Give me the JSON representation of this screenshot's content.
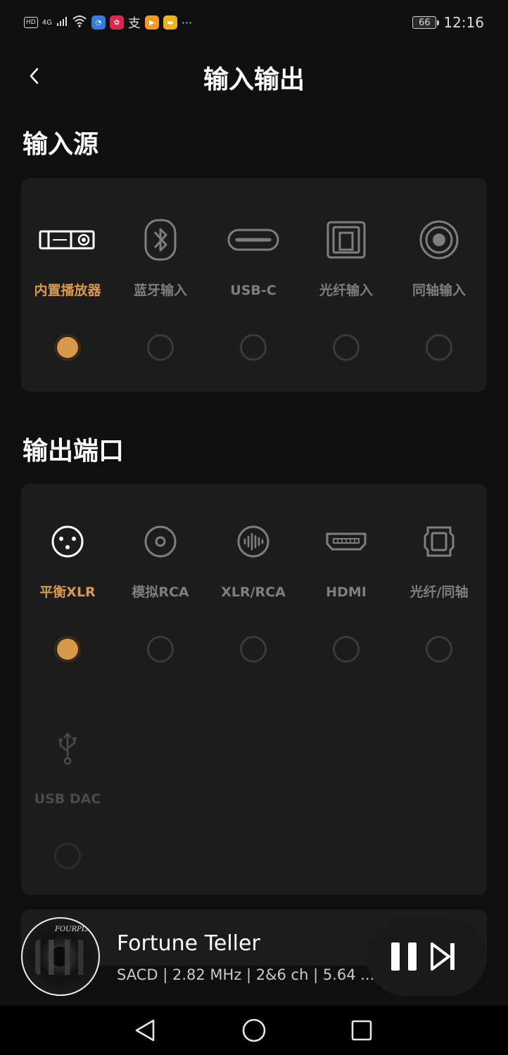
{
  "status_bar": {
    "left_label": "HD",
    "network": "4G",
    "battery": "66",
    "time": "12:16",
    "more": "···"
  },
  "header": {
    "title": "输入输出"
  },
  "input_section": {
    "title": "输入源",
    "options": [
      {
        "label": "内置播放器",
        "selected": true,
        "icon": "player-device-icon"
      },
      {
        "label": "蓝牙输入",
        "selected": false,
        "icon": "bluetooth-icon"
      },
      {
        "label": "USB-C",
        "selected": false,
        "icon": "usb-c-icon"
      },
      {
        "label": "光纤输入",
        "selected": false,
        "icon": "optical-icon"
      },
      {
        "label": "同轴输入",
        "selected": false,
        "icon": "coaxial-icon"
      }
    ]
  },
  "output_section": {
    "title": "输出端口",
    "options": [
      {
        "label": "平衡XLR",
        "selected": true,
        "icon": "xlr-icon"
      },
      {
        "label": "模拟RCA",
        "selected": false,
        "icon": "rca-icon"
      },
      {
        "label": "XLR/RCA",
        "selected": false,
        "icon": "xlr-rca-icon"
      },
      {
        "label": "HDMI",
        "selected": false,
        "icon": "hdmi-icon"
      },
      {
        "label": "光纤/同轴",
        "selected": false,
        "icon": "optical-coaxial-icon"
      },
      {
        "label": "USB DAC",
        "selected": false,
        "disabled": true,
        "icon": "usb-icon"
      }
    ]
  },
  "player": {
    "title": "Fortune Teller",
    "subtitle": "SACD | 2.82 MHz | 2&6 ch | 5.64 ...",
    "album_brand": "FOURPLAY"
  },
  "colors": {
    "accent": "#d89a48",
    "card": "#1c1c1c",
    "background": "#0f0f0f"
  }
}
